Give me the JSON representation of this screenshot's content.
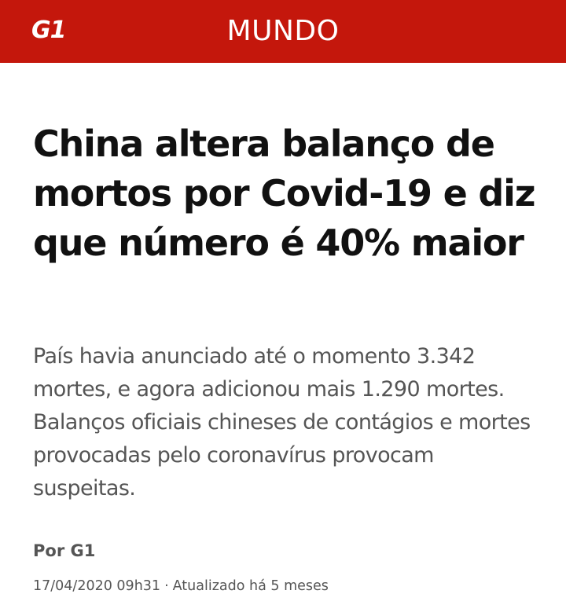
{
  "header": {
    "logo_text": "G1",
    "section": "MUNDO",
    "background_color": "#c4170c"
  },
  "article": {
    "title": "China altera balanço de mortos por Covid-19 e diz que número é 40% maior",
    "summary": "País havia anunciado até o momento 3.342 mortes, e agora adicionou mais 1.290 mortes. Balanços oficiais chineses de contágios e mortes provocadas pelo coronavírus provocam suspeitas.",
    "byline": "Por G1",
    "date": "17/04/2020 09h31",
    "separator": "·",
    "updated": "Atualizado há 5 meses"
  }
}
